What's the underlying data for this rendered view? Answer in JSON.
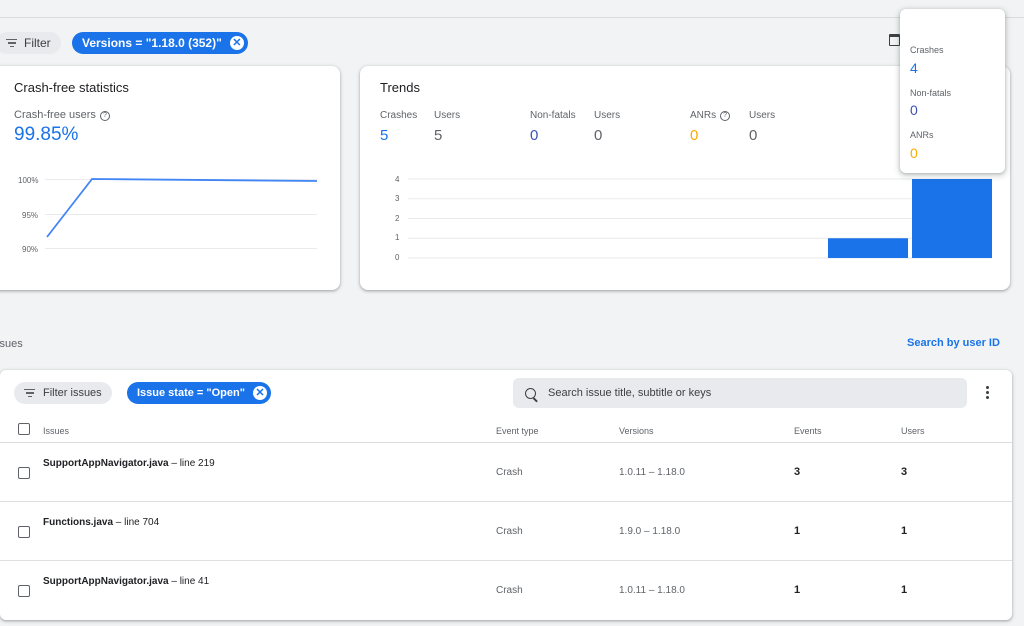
{
  "filters": {
    "filter_label": "Filter",
    "version_chip": "Versions = \"1.18.0 (352)\""
  },
  "crash_free": {
    "title": "Crash-free statistics",
    "users_label": "Crash-free users",
    "users_value": "99.85%",
    "axis_labels": [
      "100%",
      "95%",
      "90%"
    ]
  },
  "trends": {
    "title": "Trends",
    "metrics": [
      {
        "label": "Crashes",
        "value": "5",
        "color": "#1a73e8"
      },
      {
        "label": "Users",
        "value": "5",
        "color": "#5f6368"
      },
      {
        "label": "Non-fatals",
        "value": "0",
        "color": "#3f51b5"
      },
      {
        "label": "Users",
        "value": "0",
        "color": "#5f6368"
      },
      {
        "label": "ANRs",
        "value": "0",
        "color": "#f9ab00"
      },
      {
        "label": "Users",
        "value": "0",
        "color": "#5f6368"
      }
    ],
    "axis_labels": [
      "4",
      "3",
      "2",
      "1",
      "0"
    ]
  },
  "chart_data": {
    "type": "bar",
    "categories": [
      "",
      ""
    ],
    "values": [
      1,
      4
    ],
    "ylim": [
      0,
      4
    ],
    "bar_color": "#1a73e8"
  },
  "tooltip": {
    "crashes_label": "Crashes",
    "crashes_value": "4",
    "nonfatals_label": "Non-fatals",
    "nonfatals_value": "0",
    "anrs_label": "ANRs",
    "anrs_value": "0"
  },
  "issues": {
    "header": "ssues",
    "search_by_user": "Search by user ID",
    "filter_issues": "Filter issues",
    "state_chip": "Issue state = \"Open\"",
    "search_placeholder": "Search issue title, subtitle or keys",
    "columns": [
      "Issues",
      "Event type",
      "Versions",
      "Events",
      "Users"
    ],
    "rows": [
      {
        "file": "SupportAppNavigator.java",
        "line": " – line 219",
        "type": "Crash",
        "versions": "1.0.11 – 1.18.0",
        "events": "3",
        "users": "3"
      },
      {
        "file": "Functions.java",
        "line": " – line 704",
        "type": "Crash",
        "versions": "1.9.0 – 1.18.0",
        "events": "1",
        "users": "1"
      },
      {
        "file": "SupportAppNavigator.java",
        "line": " – line 41",
        "type": "Crash",
        "versions": "1.0.11 – 1.18.0",
        "events": "1",
        "users": "1"
      }
    ]
  }
}
